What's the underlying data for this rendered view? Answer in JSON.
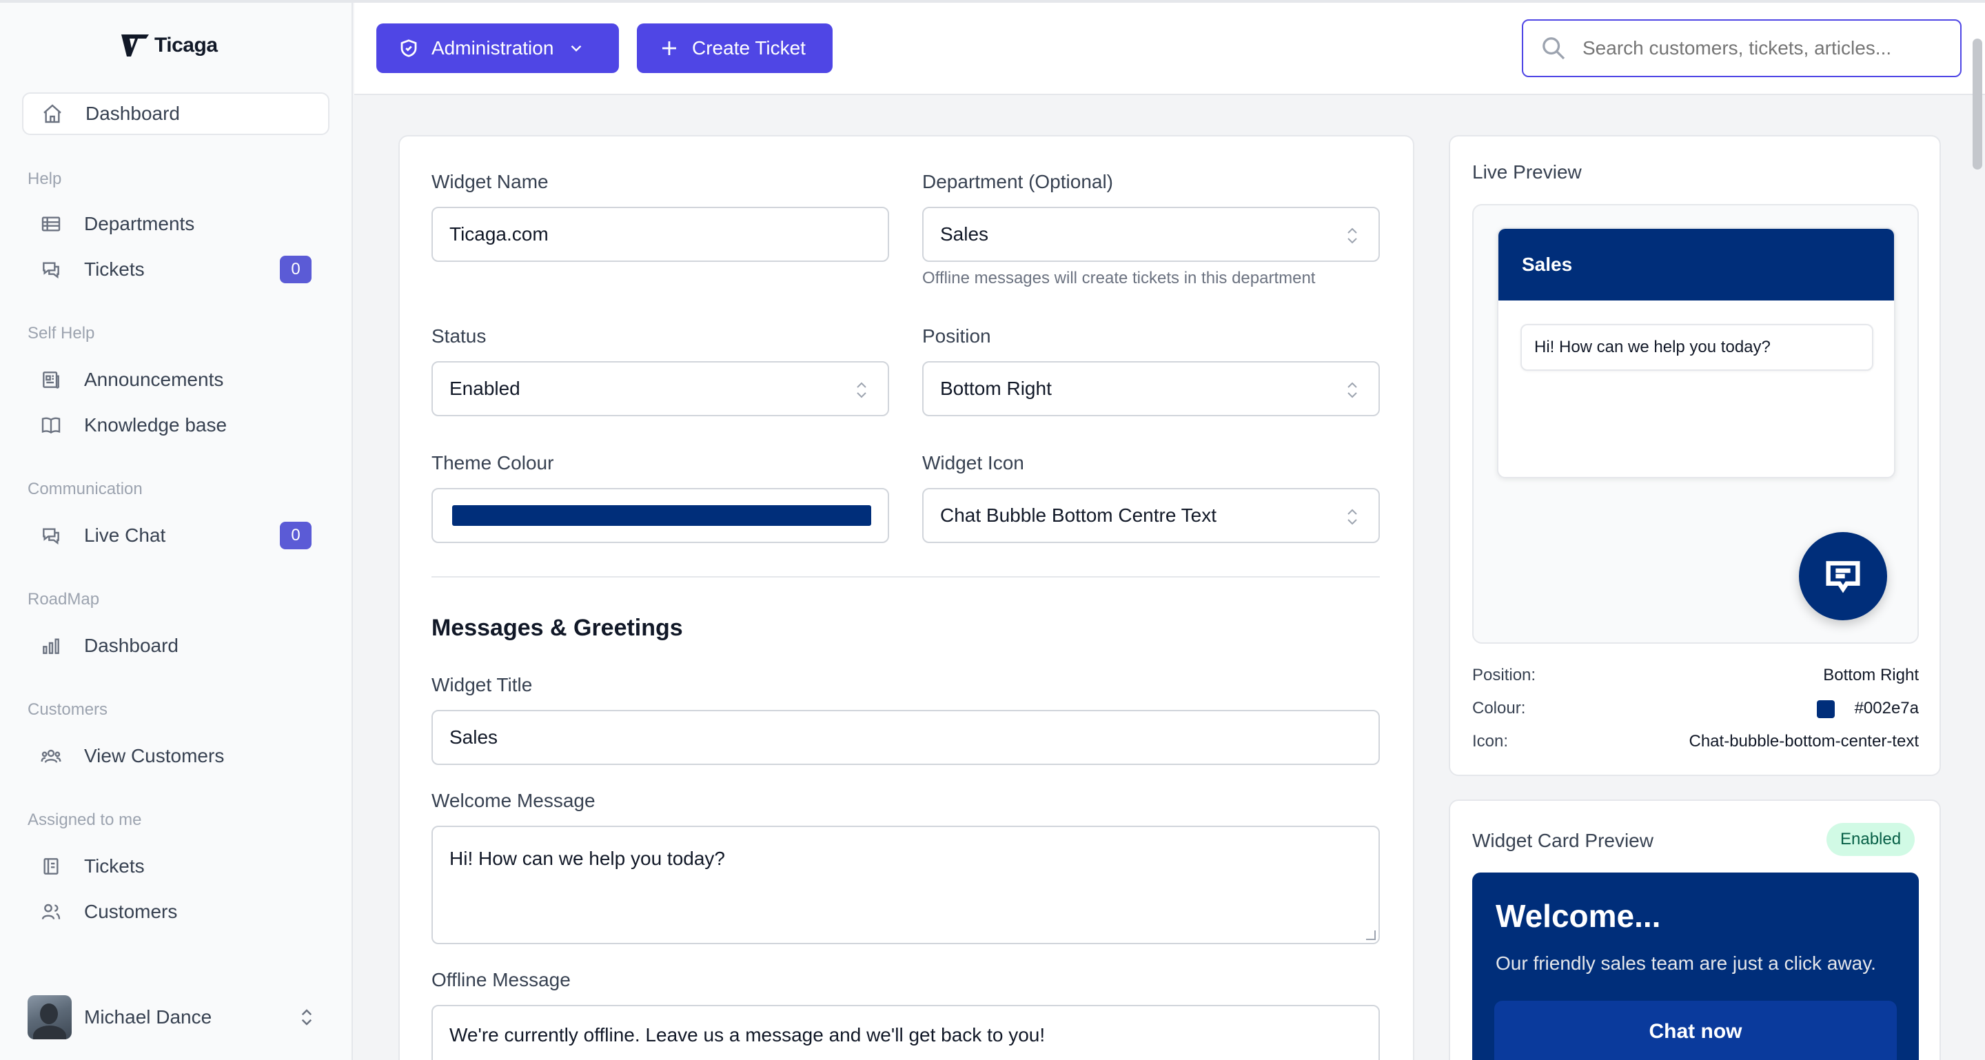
{
  "brand": {
    "name": "Ticaga"
  },
  "theme": {
    "accent": "#4f46e5",
    "widget_colour": "#002e7a"
  },
  "sidebar": {
    "dashboard": "Dashboard",
    "sections": {
      "help": "Help",
      "self_help": "Self Help",
      "communication": "Communication",
      "roadmap": "RoadMap",
      "customers": "Customers",
      "assigned": "Assigned to me"
    },
    "items": {
      "departments": "Departments",
      "tickets": "Tickets",
      "tickets_count": "0",
      "announcements": "Announcements",
      "knowledge_base": "Knowledge base",
      "live_chat": "Live Chat",
      "live_chat_count": "0",
      "roadmap_dashboard": "Dashboard",
      "view_customers": "View Customers",
      "assigned_tickets": "Tickets",
      "assigned_customers": "Customers"
    },
    "user": {
      "name": "Michael Dance"
    }
  },
  "topbar": {
    "administration_label": "Administration",
    "create_ticket_label": "Create Ticket",
    "search_placeholder": "Search customers, tickets, articles..."
  },
  "form": {
    "widget_name_label": "Widget Name",
    "widget_name_value": "Ticaga.com",
    "department_label": "Department (Optional)",
    "department_value": "Sales",
    "department_help": "Offline messages will create tickets in this department",
    "status_label": "Status",
    "status_value": "Enabled",
    "position_label": "Position",
    "position_value": "Bottom Right",
    "theme_colour_label": "Theme Colour",
    "widget_icon_label": "Widget Icon",
    "widget_icon_value": "Chat Bubble Bottom Centre Text",
    "messages_heading": "Messages & Greetings",
    "widget_title_label": "Widget Title",
    "widget_title_value": "Sales",
    "welcome_label": "Welcome Message",
    "welcome_value": "Hi! How can we help you today?",
    "offline_label": "Offline Message",
    "offline_value": "We're currently offline. Leave us a message and we'll get back to you!"
  },
  "live_preview": {
    "title": "Live Preview",
    "header": "Sales",
    "greeting": "Hi! How can we help you today?",
    "position_label": "Position:",
    "position_value": "Bottom Right",
    "colour_label": "Colour:",
    "colour_value": "#002e7a",
    "icon_label": "Icon:",
    "icon_value": "Chat-bubble-bottom-center-text"
  },
  "card_preview": {
    "title": "Widget Card Preview",
    "status": "Enabled",
    "welcome_title": "Welcome...",
    "welcome_sub": "Our friendly sales team are just a click away.",
    "cta": "Chat now"
  }
}
